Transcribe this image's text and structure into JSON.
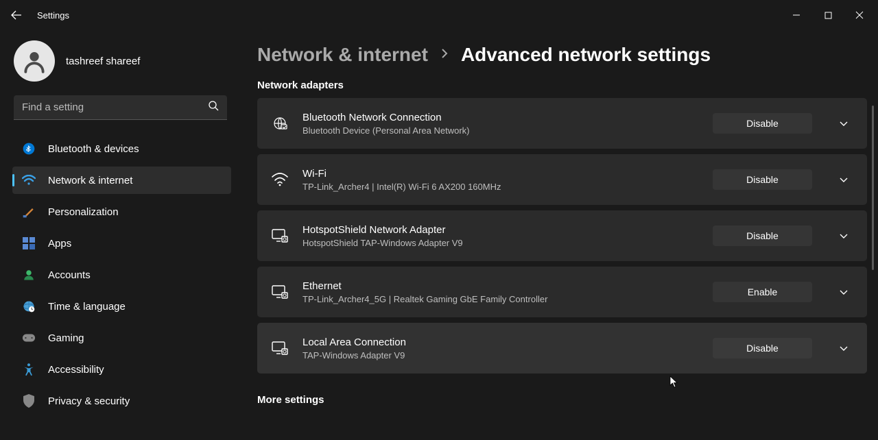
{
  "titlebar": {
    "title": "Settings"
  },
  "profile": {
    "name": "tashreef shareef"
  },
  "search": {
    "placeholder": "Find a setting"
  },
  "nav": [
    {
      "label": "Bluetooth & devices",
      "icon": "bluetooth-icon"
    },
    {
      "label": "Network & internet",
      "icon": "wifi-icon"
    },
    {
      "label": "Personalization",
      "icon": "brush-icon"
    },
    {
      "label": "Apps",
      "icon": "apps-icon"
    },
    {
      "label": "Accounts",
      "icon": "person-icon"
    },
    {
      "label": "Time & language",
      "icon": "globe-icon"
    },
    {
      "label": "Gaming",
      "icon": "gamepad-icon"
    },
    {
      "label": "Accessibility",
      "icon": "accessibility-icon"
    },
    {
      "label": "Privacy & security",
      "icon": "shield-icon"
    }
  ],
  "breadcrumb": {
    "parent": "Network & internet",
    "current": "Advanced network settings"
  },
  "section_adapters": "Network adapters",
  "section_more": "More settings",
  "adapters": [
    {
      "title": "Bluetooth Network Connection",
      "sub": "Bluetooth Device (Personal Area Network)",
      "action": "Disable"
    },
    {
      "title": "Wi-Fi",
      "sub": "TP-Link_Archer4 | Intel(R) Wi-Fi 6 AX200 160MHz",
      "action": "Disable"
    },
    {
      "title": "HotspotShield Network Adapter",
      "sub": "HotspotShield TAP-Windows Adapter V9",
      "action": "Disable"
    },
    {
      "title": "Ethernet",
      "sub": "TP-Link_Archer4_5G | Realtek Gaming GbE Family Controller",
      "action": "Enable"
    },
    {
      "title": "Local Area Connection",
      "sub": "TAP-Windows Adapter V9",
      "action": "Disable"
    }
  ]
}
